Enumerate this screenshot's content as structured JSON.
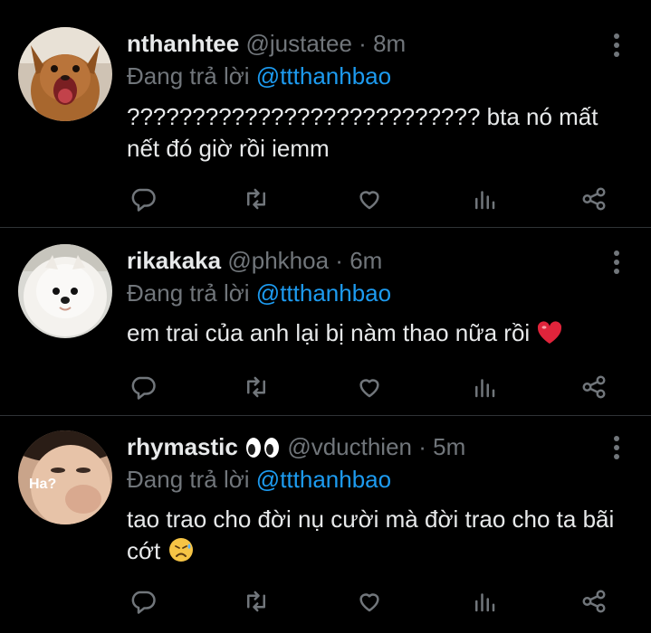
{
  "colors": {
    "background": "#000000",
    "text_primary": "#e7e9ea",
    "text_secondary": "#71767b",
    "accent": "#1d9bf0",
    "divider": "#2f3336",
    "heart_emoji": "#e0243b"
  },
  "replying_to_label": "Đang trả lời",
  "tweets": [
    {
      "display_name": "nthanhtee",
      "handle": "@justatee",
      "dot": "·",
      "time": "8m",
      "reply_to": "@ttthanhbao",
      "text": "??????????????????????????? bta nó mất nết đó giờ rồi iemm",
      "avatar": "dog-chihuahua-avatar"
    },
    {
      "display_name": "rikakaka",
      "handle": "@phkhoa",
      "dot": "·",
      "time": "6m",
      "reply_to": "@ttthanhbao",
      "text": "em trai của anh lại bị nàm thao nữa rồi",
      "emoji": "red-heart-icon",
      "avatar": "dog-pomeranian-avatar"
    },
    {
      "display_name": "rhymastic",
      "name_emoji": "eyes-icon",
      "handle": "@vducthien",
      "dot": "·",
      "time": "5m",
      "reply_to": "@ttthanhbao",
      "text": "tao trao cho đời nụ cười mà đời trao cho ta bãi cớt",
      "emoji": "sad-sweat-face-icon",
      "avatar_label": "Ha?",
      "avatar": "child-face-avatar"
    }
  ],
  "action_icons": [
    "reply-icon",
    "retweet-icon",
    "like-icon",
    "views-icon",
    "share-icon"
  ]
}
